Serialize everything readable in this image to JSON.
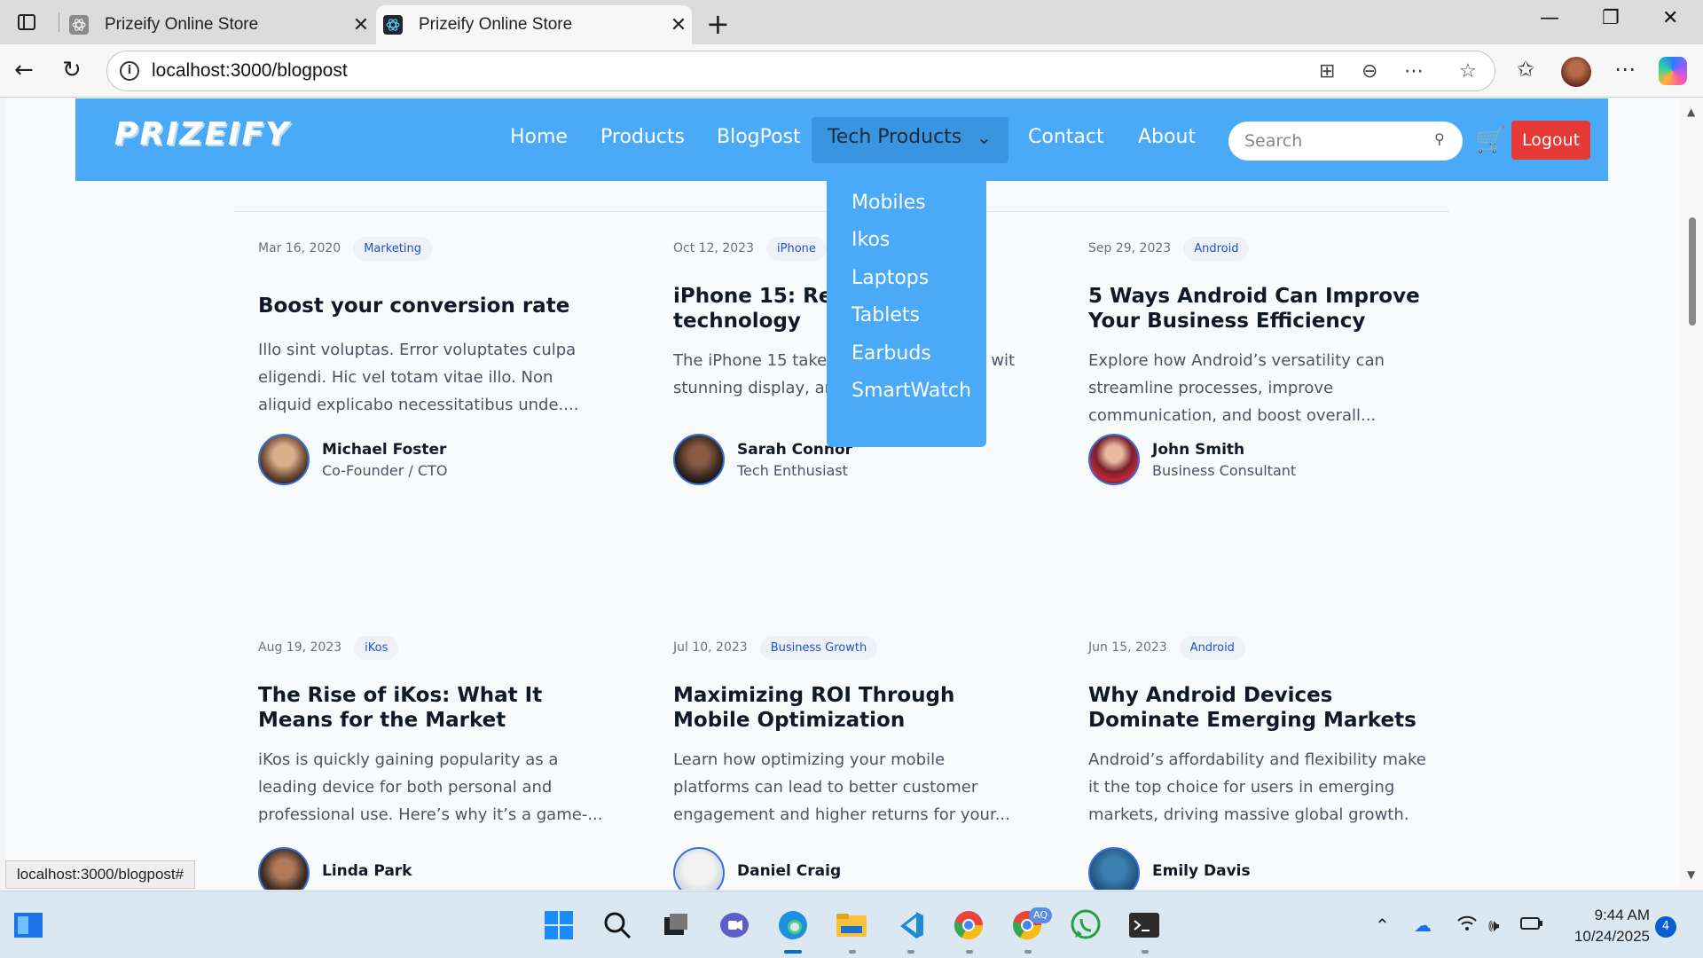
{
  "browser": {
    "tabs": [
      {
        "title": "Prizeify Online Store"
      },
      {
        "title": "Prizeify Online Store"
      }
    ],
    "url": "localhost:3000/blogpost",
    "status_url": "localhost:3000/blogpost#"
  },
  "site": {
    "logo": "PRIZEIFY",
    "nav": [
      "Home",
      "Products",
      "BlogPost"
    ],
    "dropdown_label": "Tech Products",
    "nav_right": [
      "Contact",
      "About"
    ],
    "search_placeholder": "Search",
    "logout": "Logout",
    "dropdown_items": [
      "Mobiles",
      "Ikos",
      "Laptops",
      "Tablets",
      "Earbuds",
      "SmartWatch"
    ]
  },
  "posts": [
    {
      "date": "Mar 16, 2020",
      "tag": "Marketing",
      "title": "Boost your conversion rate",
      "excerpt": "Illo sint voluptas. Error voluptates culpa eligendi. Hic vel totam vitae illo. Non aliquid explicabo necessitatibus unde....",
      "author": "Michael Foster",
      "role": "Co-Founder / CTO"
    },
    {
      "date": "Oct 12, 2023",
      "tag": "iPhone",
      "title": "iPhone 15: Revo le technology",
      "excerpt": "The iPhone 15 takes e to the next level wit stunning display, ar",
      "author": "Sarah Connor",
      "role": "Tech Enthusiast"
    },
    {
      "date": "Sep 29, 2023",
      "tag": "Android",
      "title": "5 Ways Android Can Improve Your Business Efficiency",
      "excerpt": "Explore how Android’s versatility can streamline processes, improve communication, and boost overall...",
      "author": "John Smith",
      "role": "Business Consultant"
    },
    {
      "date": "Aug 19, 2023",
      "tag": "iKos",
      "title": "The Rise of iKos: What It Means for the Market",
      "excerpt": "iKos is quickly gaining popularity as a leading device for both personal and professional use. Here’s why it’s a game-...",
      "author": "Linda Park",
      "role": ""
    },
    {
      "date": "Jul 10, 2023",
      "tag": "Business Growth",
      "title": "Maximizing ROI Through Mobile Optimization",
      "excerpt": "Learn how optimizing your mobile platforms can lead to better customer engagement and higher returns for your...",
      "author": "Daniel Craig",
      "role": ""
    },
    {
      "date": "Jun 15, 2023",
      "tag": "Android",
      "title": "Why Android Devices Dominate Emerging Markets",
      "excerpt": "Android’s affordability and flexibility make it the top choice for users in emerging markets, driving massive global growth.",
      "author": "Emily Davis",
      "role": ""
    }
  ],
  "taskbar": {
    "time": "9:44 AM",
    "date": "10/24/2025",
    "notifications": "4",
    "chrome_badge": "AQ"
  },
  "colors": {
    "nav_bg": "#4aaaf7",
    "logout_bg": "#e53935",
    "tag_text": "#1f55c7"
  }
}
